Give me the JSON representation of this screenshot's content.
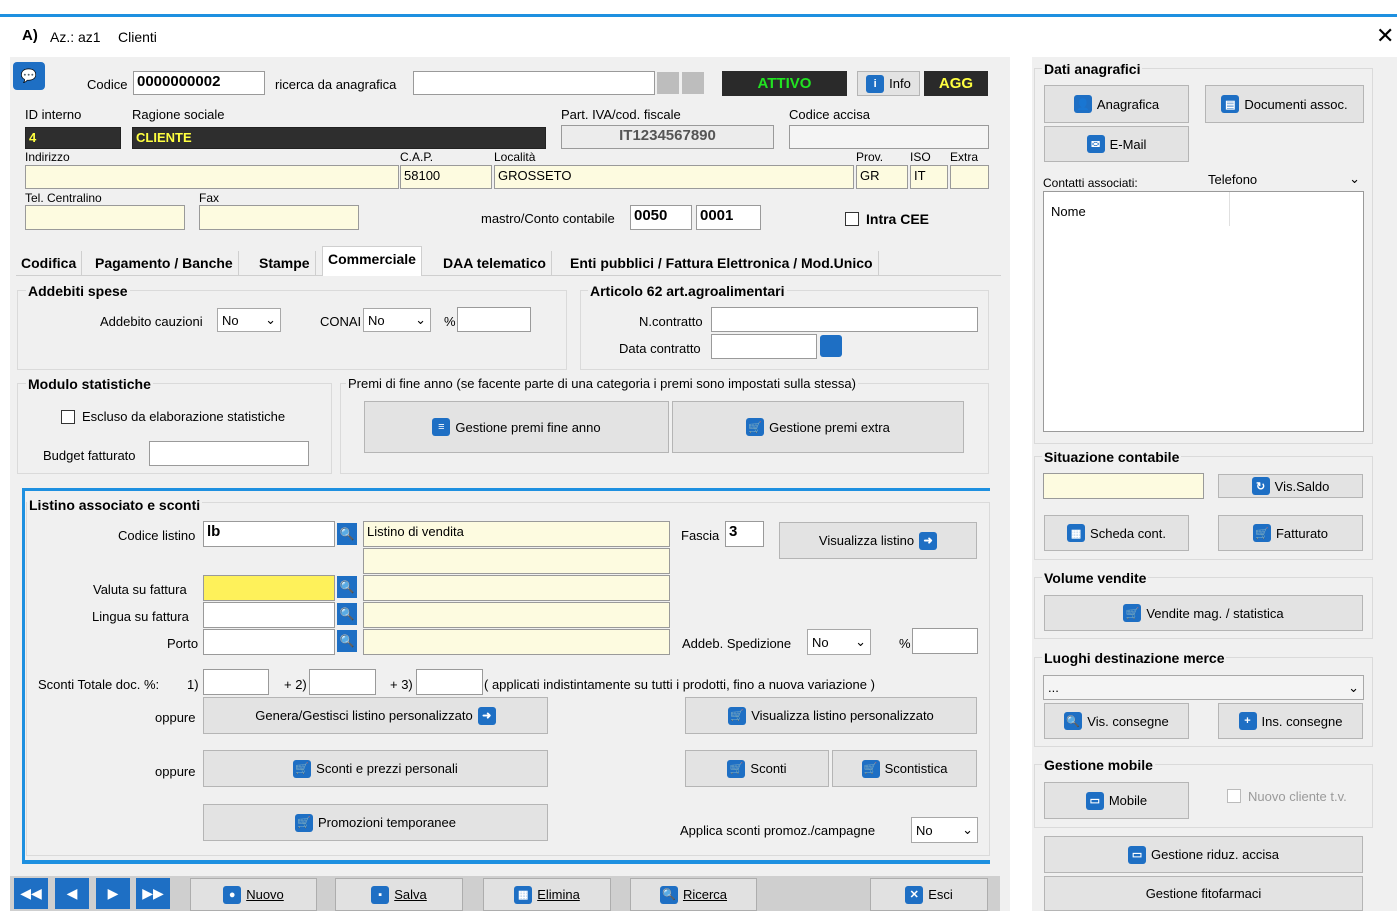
{
  "window": {
    "app_short": "Az.: az1",
    "title": "Clienti"
  },
  "header": {
    "codice_label": "Codice",
    "codice_value": "0000000002",
    "ricerca_label": "ricerca da anagrafica",
    "status": "ATTIVO",
    "info_label": "Info",
    "agg_label": "AGG"
  },
  "fields": {
    "id_interno_label": "ID interno",
    "id_interno_value": "4",
    "ragione_sociale_label": "Ragione sociale",
    "ragione_sociale_value": "CLIENTE",
    "piva_label": "Part. IVA/cod. fiscale",
    "piva_value": "IT1234567890",
    "accisa_label": "Codice accisa",
    "indirizzo_label": "Indirizzo",
    "cap_label": "C.A.P.",
    "cap_value": "58100",
    "localita_label": "Località",
    "localita_value": "GROSSETO",
    "prov_label": "Prov.",
    "prov_value": "GR",
    "iso_label": "ISO",
    "iso_value": "IT",
    "extra_label": "Extra",
    "tel_label": "Tel. Centralino",
    "fax_label": "Fax",
    "mastro_label": "mastro/Conto contabile",
    "mastro_value": "0050",
    "conto_value": "0001",
    "intra_label": "Intra CEE"
  },
  "tabs": [
    "Codifica",
    "Pagamento / Banche",
    "Stampe",
    "Commerciale",
    "DAA telematico",
    "Enti pubblici / Fattura Elettronica / Mod.Unico"
  ],
  "addebiti": {
    "title": "Addebiti spese",
    "cauzioni_label": "Addebito cauzioni",
    "cauzioni_value": "No",
    "conai_label": "CONAI",
    "conai_value": "No",
    "percent": "%"
  },
  "art62": {
    "title": "Articolo 62 art.agroalimentari",
    "ncontratto_label": "N.contratto",
    "data_label": "Data contratto"
  },
  "statistiche": {
    "title": "Modulo statistiche",
    "escluso_label": "Escluso da elaborazione statistiche",
    "budget_label": "Budget fatturato"
  },
  "premi": {
    "title": "Premi di fine anno (se facente parte di una categoria i premi sono impostati sulla stessa)",
    "btn_fine_anno": "Gestione premi fine anno",
    "btn_extra": "Gestione premi extra"
  },
  "listino": {
    "title": "Listino associato e sconti",
    "codice_label": "Codice listino",
    "codice_value": "lb",
    "desc_value": "Listino di vendita",
    "fascia_label": "Fascia",
    "fascia_value": "3",
    "visualizza_btn": "Visualizza listino",
    "valuta_label": "Valuta su fattura",
    "lingua_label": "Lingua su fattura",
    "porto_label": "Porto",
    "spedizione_label": "Addeb. Spedizione",
    "spedizione_value": "No",
    "percent": "%",
    "sconti_label": "Sconti Totale doc. %:",
    "s1": "1)",
    "s2": "+ 2)",
    "s3": "+ 3)",
    "sconti_note": "( applicati indistintamente su tutti i prodotti, fino a nuova variazione )",
    "oppure": "oppure",
    "genera_btn": "Genera/Gestisci listino personalizzato",
    "vis_pers_btn": "Visualizza listino personalizzato",
    "sconti_prezzi_btn": "Sconti e prezzi personali",
    "sconti_btn": "Sconti",
    "scontistica_btn": "Scontistica",
    "promo_btn": "Promozioni temporanee",
    "applica_label": "Applica sconti promoz./campagne",
    "applica_value": "No"
  },
  "toolbar": {
    "nuovo": "Nuovo",
    "salva": "Salva",
    "elimina": "Elimina",
    "ricerca": "Ricerca",
    "esci": "Esci"
  },
  "right": {
    "dati_title": "Dati anagrafici",
    "anagrafica_btn": "Anagrafica",
    "documenti_btn": "Documenti assoc.",
    "email_btn": "E-Mail",
    "contatti_label": "Contatti associati:",
    "contatti_select": "Telefono",
    "nome_col": "Nome",
    "situazione_title": "Situazione contabile",
    "vis_saldo_btn": "Vis.Saldo",
    "scheda_btn": "Scheda cont.",
    "fatturato_btn": "Fatturato",
    "volume_title": "Volume vendite",
    "vendite_btn": "Vendite mag. / statistica",
    "luoghi_title": "Luoghi destinazione merce",
    "luoghi_select": "...",
    "vis_consegne_btn": "Vis. consegne",
    "ins_consegne_btn": "Ins. consegne",
    "mobile_title": "Gestione mobile",
    "mobile_btn": "Mobile",
    "nuovo_cliente_label": "Nuovo cliente t.v.",
    "riduz_btn": "Gestione riduz. accisa",
    "fito_btn": "Gestione fitofarmaci"
  }
}
